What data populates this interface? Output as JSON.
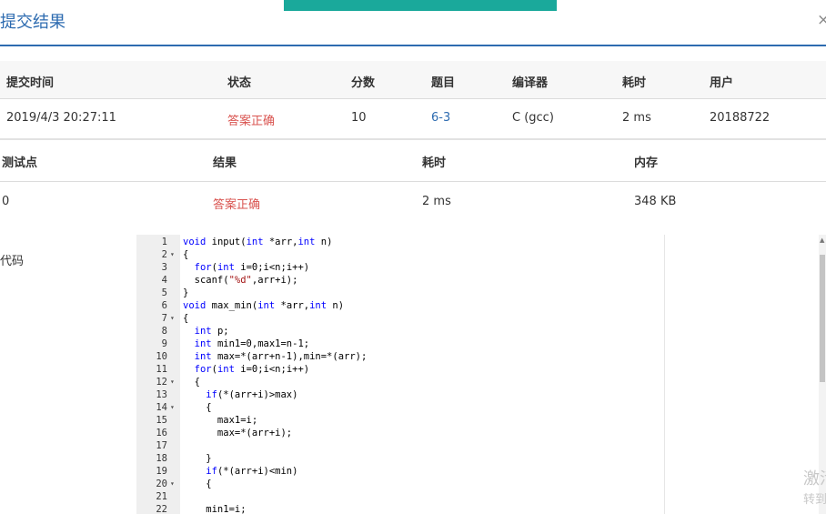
{
  "dialog": {
    "title": "提交结果",
    "close_glyph": "×"
  },
  "submission": {
    "headers": [
      "提交时间",
      "状态",
      "分数",
      "题目",
      "编译器",
      "耗时",
      "用户"
    ],
    "row": {
      "time": "2019/4/3 20:27:11",
      "status": "答案正确",
      "score": "10",
      "problem": "6-3",
      "compiler": "C (gcc)",
      "elapsed": "2 ms",
      "user": "20188722"
    }
  },
  "testcases": {
    "headers": [
      "测试点",
      "结果",
      "耗时",
      "内存"
    ],
    "rows": [
      {
        "id": "0",
        "result": "答案正确",
        "time": "2 ms",
        "memory": "348 KB"
      }
    ]
  },
  "code_section": {
    "label": "代码"
  },
  "code": {
    "lines": [
      {
        "n": "1",
        "fold": "",
        "text": "void input(int *arr,int n)"
      },
      {
        "n": "2",
        "fold": "▾",
        "text": "{"
      },
      {
        "n": "3",
        "fold": "",
        "text": "  for(int i=0;i<n;i++)"
      },
      {
        "n": "4",
        "fold": "",
        "text": "  scanf(\"%d\",arr+i);"
      },
      {
        "n": "5",
        "fold": "",
        "text": "}"
      },
      {
        "n": "6",
        "fold": "",
        "text": "void max_min(int *arr,int n)"
      },
      {
        "n": "7",
        "fold": "▾",
        "text": "{"
      },
      {
        "n": "8",
        "fold": "",
        "text": "  int p;"
      },
      {
        "n": "9",
        "fold": "",
        "text": "  int min1=0,max1=n-1;"
      },
      {
        "n": "10",
        "fold": "",
        "text": "  int max=*(arr+n-1),min=*(arr);"
      },
      {
        "n": "11",
        "fold": "",
        "text": "  for(int i=0;i<n;i++)"
      },
      {
        "n": "12",
        "fold": "▾",
        "text": "  {"
      },
      {
        "n": "13",
        "fold": "",
        "text": "    if(*(arr+i)>max)"
      },
      {
        "n": "14",
        "fold": "▾",
        "text": "    {"
      },
      {
        "n": "15",
        "fold": "",
        "text": "      max1=i;"
      },
      {
        "n": "16",
        "fold": "",
        "text": "      max=*(arr+i);"
      },
      {
        "n": "17",
        "fold": "",
        "text": ""
      },
      {
        "n": "18",
        "fold": "",
        "text": "    }"
      },
      {
        "n": "19",
        "fold": "",
        "text": "    if(*(arr+i)<min)"
      },
      {
        "n": "20",
        "fold": "▾",
        "text": "    {"
      },
      {
        "n": "21",
        "fold": "",
        "text": ""
      },
      {
        "n": "22",
        "fold": "",
        "text": "    min1=i;"
      }
    ]
  },
  "watermark": {
    "line1": "激活",
    "line2": "转到"
  },
  "colors": {
    "accent": "#2d6bb0",
    "success": "#d9534f",
    "top_bar": "#1aa99b"
  }
}
